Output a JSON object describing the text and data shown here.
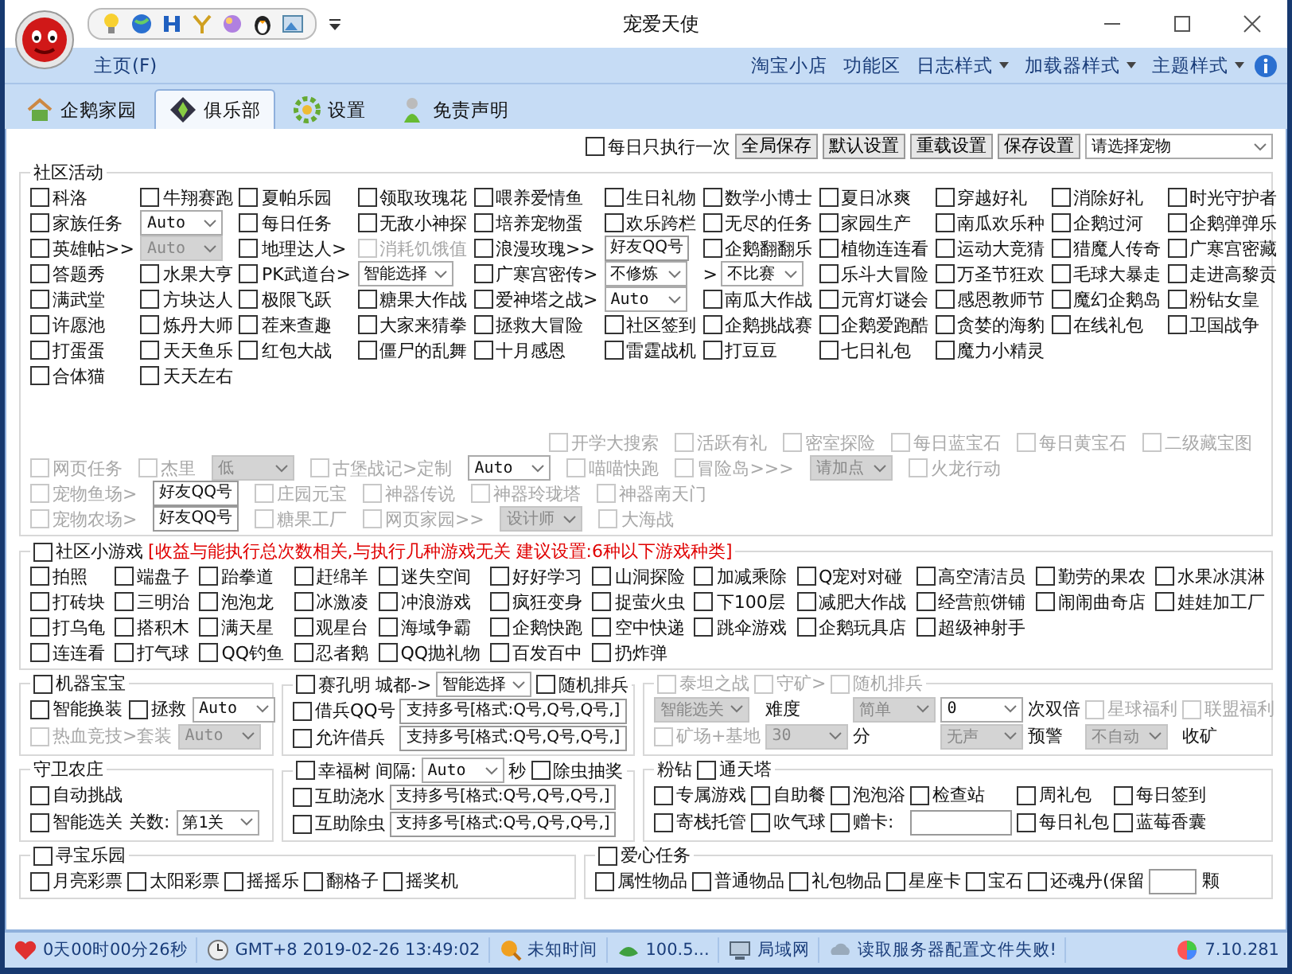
{
  "window": {
    "title": "宠爱天使"
  },
  "menu": {
    "home": "主页(F)",
    "items": [
      {
        "label": "淘宝小店",
        "has_dropdown": false
      },
      {
        "label": "功能区",
        "has_dropdown": false
      },
      {
        "label": "日志样式",
        "has_dropdown": true
      },
      {
        "label": "加载器样式",
        "has_dropdown": true
      },
      {
        "label": "主题样式",
        "has_dropdown": true
      }
    ]
  },
  "tabs": [
    {
      "label": "企鹅家园",
      "selected": false
    },
    {
      "label": "俱乐部",
      "selected": true
    },
    {
      "label": "设置",
      "selected": false
    },
    {
      "label": "免责声明",
      "selected": false
    }
  ],
  "toolbar": [
    {
      "kind": "check",
      "label": "每日只执行一次",
      "checked": false
    },
    {
      "kind": "button",
      "label": "全局保存"
    },
    {
      "kind": "button",
      "label": "默认设置"
    },
    {
      "kind": "button",
      "label": "重载设置"
    },
    {
      "kind": "button",
      "label": "保存设置"
    },
    {
      "kind": "select",
      "value": "请选择宠物"
    }
  ],
  "community": {
    "title": "社区活动",
    "rows": [
      [
        {
          "kind": "check",
          "label": "科洛",
          "checked": false
        },
        {
          "kind": "check",
          "label": "牛翔赛跑",
          "checked": false
        },
        {
          "kind": "check",
          "label": "夏帕乐园",
          "checked": false
        },
        {
          "kind": "check",
          "label": "领取玫瑰花",
          "checked": false
        },
        {
          "kind": "check",
          "label": "喂养爱情鱼",
          "checked": false
        },
        {
          "kind": "check",
          "label": "生日礼物",
          "checked": false
        },
        {
          "kind": "check",
          "label": "数学小博士",
          "checked": false
        },
        {
          "kind": "check",
          "label": "夏日冰爽",
          "checked": false
        },
        {
          "kind": "check",
          "label": "穿越好礼",
          "checked": false
        },
        {
          "kind": "check",
          "label": "消除好礼",
          "checked": false
        },
        {
          "kind": "check",
          "label": "时光守护者",
          "checked": false
        }
      ],
      [
        {
          "kind": "check",
          "label": "家族任务",
          "checked": false
        },
        {
          "kind": "select",
          "value": "Auto"
        },
        {
          "kind": "check",
          "label": "每日任务",
          "checked": false
        },
        {
          "kind": "check",
          "label": "无敌小神探",
          "checked": false
        },
        {
          "kind": "check",
          "label": "培养宠物蛋",
          "checked": false
        },
        {
          "kind": "check",
          "label": "欢乐跨栏",
          "checked": false
        },
        {
          "kind": "check",
          "label": "无尽的任务",
          "checked": false
        },
        {
          "kind": "check",
          "label": "家园生产",
          "checked": false
        },
        {
          "kind": "check",
          "label": "南瓜欢乐种",
          "checked": false
        },
        {
          "kind": "check",
          "label": "企鹅过河",
          "checked": false
        },
        {
          "kind": "check",
          "label": "企鹅弹弹乐",
          "checked": false
        }
      ],
      [
        {
          "kind": "check",
          "label": "英雄帖>>",
          "checked": false,
          "disabled": false
        },
        {
          "kind": "select",
          "value": "Auto",
          "disabled": true
        },
        {
          "kind": "check",
          "label": "地理达人>",
          "checked": false,
          "disabled": false
        },
        {
          "kind": "check",
          "label": "消耗饥饿值",
          "checked": false,
          "disabled": true
        },
        {
          "kind": "check",
          "label": "浪漫玫瑰>>",
          "checked": false,
          "disabled": false
        },
        {
          "kind": "input",
          "value": "好友QQ号",
          "disabled": false
        },
        {
          "kind": "check",
          "label": "企鹅翻翻乐",
          "checked": false,
          "disabled": false
        },
        {
          "kind": "check",
          "label": "植物连连看",
          "checked": false,
          "disabled": false
        },
        {
          "kind": "check",
          "label": "运动大竞猜",
          "checked": false,
          "disabled": false
        },
        {
          "kind": "check",
          "label": "猎魔人传奇",
          "checked": false,
          "disabled": false
        },
        {
          "kind": "check",
          "label": "广寒宫密藏",
          "checked": false,
          "disabled": false
        }
      ],
      [
        {
          "kind": "check",
          "label": "答题秀",
          "checked": false
        },
        {
          "kind": "check",
          "label": "水果大亨",
          "checked": false
        },
        {
          "kind": "check",
          "label": "PK武道台>",
          "checked": false
        },
        {
          "kind": "select",
          "value": "智能选择"
        },
        {
          "kind": "check",
          "label": "广寒宫密传>",
          "checked": false
        },
        {
          "kind": "select",
          "value": "不修炼"
        },
        {
          "kind": "select",
          "prefix": ">",
          "value": "不比赛"
        },
        {
          "kind": "check",
          "label": "乐斗大冒险",
          "checked": false
        },
        {
          "kind": "check",
          "label": "万圣节狂欢",
          "checked": false
        },
        {
          "kind": "check",
          "label": "毛球大暴走",
          "checked": false
        },
        {
          "kind": "check",
          "label": "走进高黎贡",
          "checked": false
        }
      ],
      [
        {
          "kind": "check",
          "label": "满武堂",
          "checked": false
        },
        {
          "kind": "check",
          "label": "方块达人",
          "checked": false
        },
        {
          "kind": "check",
          "label": "极限飞跃",
          "checked": false
        },
        {
          "kind": "check",
          "label": "糖果大作战",
          "checked": false
        },
        {
          "kind": "check",
          "label": "爱神塔之战>",
          "checked": false
        },
        {
          "kind": "select",
          "value": "Auto"
        },
        {
          "kind": "check",
          "label": "南瓜大作战",
          "checked": false
        },
        {
          "kind": "check",
          "label": "元宵灯谜会",
          "checked": false
        },
        {
          "kind": "check",
          "label": "感恩教师节",
          "checked": false
        },
        {
          "kind": "check",
          "label": "魔幻企鹅岛",
          "checked": false
        },
        {
          "kind": "check",
          "label": "粉钻女皇",
          "checked": false
        }
      ],
      [
        {
          "kind": "check",
          "label": "许愿池",
          "checked": false
        },
        {
          "kind": "check",
          "label": "炼丹大师",
          "checked": false
        },
        {
          "kind": "check",
          "label": "茬来查趣",
          "checked": false
        },
        {
          "kind": "check",
          "label": "大家来猜拳",
          "checked": false
        },
        {
          "kind": "check",
          "label": "拯救大冒险",
          "checked": false
        },
        {
          "kind": "check",
          "label": "社区签到",
          "checked": false
        },
        {
          "kind": "check",
          "label": "企鹅挑战赛",
          "checked": false
        },
        {
          "kind": "check",
          "label": "企鹅爱跑酷",
          "checked": false
        },
        {
          "kind": "check",
          "label": "贪婪的海豹",
          "checked": false
        },
        {
          "kind": "check",
          "label": "在线礼包",
          "checked": false
        },
        {
          "kind": "check",
          "label": "卫国战争",
          "checked": false
        }
      ],
      [
        {
          "kind": "check",
          "label": "打蛋蛋",
          "checked": false
        },
        {
          "kind": "check",
          "label": "天天鱼乐",
          "checked": false
        },
        {
          "kind": "check",
          "label": "红包大战",
          "checked": false
        },
        {
          "kind": "check",
          "label": "僵尸的乱舞",
          "checked": false
        },
        {
          "kind": "check",
          "label": "十月感恩",
          "checked": false
        },
        {
          "kind": "check",
          "label": "雷霆战机",
          "checked": false
        },
        {
          "kind": "check",
          "label": "打豆豆",
          "checked": false
        },
        {
          "kind": "check",
          "label": "七日礼包",
          "checked": false
        },
        {
          "kind": "check",
          "label": "魔力小精灵",
          "checked": false
        }
      ],
      [
        {
          "kind": "check",
          "label": "合体猫",
          "checked": false
        },
        {
          "kind": "check",
          "label": "天天左右",
          "checked": false
        }
      ]
    ],
    "gray_rows": [
      [
        {
          "kind": "check",
          "label": "开学大搜索",
          "checked": false,
          "disabled": true
        },
        {
          "kind": "check",
          "label": "活跃有礼",
          "checked": false,
          "disabled": true
        },
        {
          "kind": "check",
          "label": "密室探险",
          "checked": false,
          "disabled": true
        },
        {
          "kind": "check",
          "label": "每日蓝宝石",
          "checked": false,
          "disabled": true
        },
        {
          "kind": "check",
          "label": "每日黄宝石",
          "checked": false,
          "disabled": true
        },
        {
          "kind": "check",
          "label": "二级藏宝图",
          "checked": false,
          "disabled": true
        }
      ],
      [
        {
          "kind": "check",
          "label": "网页任务",
          "checked": false,
          "disabled": true
        },
        {
          "kind": "check",
          "label": "杰里",
          "checked": false,
          "disabled": true
        },
        {
          "kind": "select",
          "value": "低",
          "disabled": true
        },
        {
          "kind": "check",
          "label": "古堡战记>定制",
          "checked": false,
          "disabled": true
        },
        {
          "kind": "select",
          "value": "Auto",
          "disabled": false
        },
        {
          "kind": "check",
          "label": "喵喵快跑",
          "checked": false,
          "disabled": true
        },
        {
          "kind": "check",
          "label": "冒险岛>>>",
          "checked": false,
          "disabled": true
        },
        {
          "kind": "select",
          "value": "请加点",
          "disabled": true
        },
        {
          "kind": "check",
          "label": "火龙行动",
          "checked": false,
          "disabled": true
        }
      ],
      [
        {
          "kind": "check",
          "label": "宠物鱼场>",
          "checked": false,
          "disabled": true
        },
        {
          "kind": "input",
          "value": "好友QQ号",
          "disabled": false
        },
        {
          "kind": "check",
          "label": "庄园元宝",
          "checked": false,
          "disabled": true
        },
        {
          "kind": "check",
          "label": "神器传说",
          "checked": false,
          "disabled": true
        },
        {
          "kind": "check",
          "label": "神器玲珑塔",
          "checked": false,
          "disabled": true
        },
        {
          "kind": "check",
          "label": "神器南天门",
          "checked": false,
          "disabled": true
        }
      ],
      [
        {
          "kind": "check",
          "label": "宠物农场>",
          "checked": false,
          "disabled": true
        },
        {
          "kind": "input",
          "value": "好友QQ号",
          "disabled": false
        },
        {
          "kind": "check",
          "label": "糖果工厂",
          "checked": false,
          "disabled": true
        },
        {
          "kind": "check",
          "label": "网页家园>>",
          "checked": false,
          "disabled": true
        },
        {
          "kind": "select",
          "value": "设计师",
          "disabled": true
        },
        {
          "kind": "check",
          "label": "大海战",
          "checked": false,
          "disabled": true
        }
      ]
    ]
  },
  "mini_games": {
    "header": {
      "kind": "check",
      "label": "社区小游戏",
      "checked": false
    },
    "note": "[收益与能执行总次数相关,与执行几种游戏无关 建议设置:6种以下游戏种类]",
    "rows": [
      [
        {
          "kind": "check",
          "label": "拍照",
          "checked": false
        },
        {
          "kind": "check",
          "label": "端盘子",
          "checked": false
        },
        {
          "kind": "check",
          "label": "跆拳道",
          "checked": false
        },
        {
          "kind": "check",
          "label": "赶绵羊",
          "checked": false
        },
        {
          "kind": "check",
          "label": "迷失空间",
          "checked": false
        },
        {
          "kind": "check",
          "label": "好好学习",
          "checked": false
        },
        {
          "kind": "check",
          "label": "山洞探险",
          "checked": false
        },
        {
          "kind": "check",
          "label": "加减乘除",
          "checked": false
        },
        {
          "kind": "check",
          "label": "Q宠对对碰",
          "checked": false
        },
        {
          "kind": "check",
          "label": "高空清洁员",
          "checked": false
        },
        {
          "kind": "check",
          "label": "勤劳的果农",
          "checked": false
        },
        {
          "kind": "check",
          "label": "水果冰淇淋",
          "checked": false
        }
      ],
      [
        {
          "kind": "check",
          "label": "打砖块",
          "checked": false
        },
        {
          "kind": "check",
          "label": "三明治",
          "checked": false
        },
        {
          "kind": "check",
          "label": "泡泡龙",
          "checked": false
        },
        {
          "kind": "check",
          "label": "冰激凌",
          "checked": false
        },
        {
          "kind": "check",
          "label": "冲浪游戏",
          "checked": false
        },
        {
          "kind": "check",
          "label": "疯狂变身",
          "checked": false
        },
        {
          "kind": "check",
          "label": "捉萤火虫",
          "checked": false
        },
        {
          "kind": "check",
          "label": "下100层",
          "checked": false
        },
        {
          "kind": "check",
          "label": "减肥大作战",
          "checked": false
        },
        {
          "kind": "check",
          "label": "经营煎饼铺",
          "checked": false
        },
        {
          "kind": "check",
          "label": "闹闹曲奇店",
          "checked": false
        },
        {
          "kind": "check",
          "label": "娃娃加工厂",
          "checked": false
        }
      ],
      [
        {
          "kind": "check",
          "label": "打乌龟",
          "checked": false
        },
        {
          "kind": "check",
          "label": "搭积木",
          "checked": false
        },
        {
          "kind": "check",
          "label": "满天星",
          "checked": false
        },
        {
          "kind": "check",
          "label": "观星台",
          "checked": false
        },
        {
          "kind": "check",
          "label": "海域争霸",
          "checked": false
        },
        {
          "kind": "check",
          "label": "企鹅快跑",
          "checked": false
        },
        {
          "kind": "check",
          "label": "空中快递",
          "checked": false
        },
        {
          "kind": "check",
          "label": "跳伞游戏",
          "checked": false
        },
        {
          "kind": "check",
          "label": "企鹅玩具店",
          "checked": false
        },
        {
          "kind": "check",
          "label": "超级神射手",
          "checked": false
        }
      ],
      [
        {
          "kind": "check",
          "label": "连连看",
          "checked": false
        },
        {
          "kind": "check",
          "label": "打气球",
          "checked": false
        },
        {
          "kind": "check",
          "label": "QQ钓鱼",
          "checked": false
        },
        {
          "kind": "check",
          "label": "忍者鹅",
          "checked": false
        },
        {
          "kind": "check",
          "label": "QQ抛礼物",
          "checked": false
        },
        {
          "kind": "check",
          "label": "百发百中",
          "checked": false
        },
        {
          "kind": "check",
          "label": "扔炸弹",
          "checked": false
        }
      ]
    ]
  },
  "panel_rows": [
    [
      {
        "legend": [
          {
            "kind": "check",
            "label": "机器宝宝",
            "checked": false
          }
        ],
        "rows": [
          [
            {
              "kind": "check",
              "label": "智能换装",
              "checked": false,
              "disabled": false
            },
            {
              "kind": "check",
              "label": "拯救",
              "checked": false,
              "disabled": false
            },
            {
              "kind": "select",
              "value": "Auto",
              "disabled": false
            }
          ],
          [
            {
              "kind": "check",
              "label": "热血竞技>套装",
              "checked": false,
              "disabled": true,
              "select": {
                "kind": "select",
                "value": "Auto",
                "disabled": true
              }
            }
          ]
        ]
      },
      {
        "legend": [
          {
            "kind": "check",
            "label": "赛孔明",
            "checked": false
          },
          {
            "kind": "text",
            "label": "城都->"
          },
          {
            "kind": "select",
            "value": "智能选择"
          },
          {
            "kind": "check",
            "label": "随机排兵",
            "checked": false
          }
        ],
        "rows": [
          [
            {
              "kind": "check",
              "label": "借兵QQ号",
              "checked": false
            },
            {
              "kind": "input",
              "value": "支持多号[格式:Q号,Q号,Q号,]"
            }
          ],
          [
            {
              "kind": "check",
              "label": "允许借兵",
              "checked": false
            },
            {
              "kind": "input",
              "value": "支持多号[格式:Q号,Q号,Q号,]"
            }
          ]
        ]
      },
      {
        "legend": [
          {
            "kind": "check",
            "label": "泰坦之战",
            "checked": false,
            "disabled": true
          },
          {
            "kind": "check",
            "label": "守矿>",
            "checked": false,
            "disabled": true
          },
          {
            "kind": "check",
            "label": "随机排兵",
            "checked": false,
            "disabled": true
          }
        ],
        "rows": [
          [
            {
              "kind": "select",
              "value": "智能选关",
              "disabled": true
            },
            {
              "kind": "text",
              "label": "难度",
              "disabled": false
            },
            {
              "kind": "select",
              "value": "简单",
              "disabled": true
            },
            {
              "kind": "select",
              "value": "0",
              "disabled": false
            },
            {
              "kind": "text",
              "label": "次双倍",
              "disabled": false
            },
            {
              "kind": "check",
              "label": "星球福利",
              "checked": false,
              "disabled": true
            },
            {
              "kind": "check",
              "label": "联盟福利",
              "checked": false,
              "disabled": true
            }
          ],
          [
            {
              "kind": "check",
              "label": "矿场+基地",
              "checked": false,
              "disabled": true
            },
            {
              "kind": "select",
              "value": "30",
              "disabled": true
            },
            {
              "kind": "text",
              "label": "分",
              "disabled": false
            },
            {
              "kind": "select",
              "value": "无声",
              "disabled": true
            },
            {
              "kind": "text",
              "label": "预警",
              "disabled": false
            },
            {
              "kind": "select",
              "value": "不自动",
              "disabled": true
            },
            {
              "kind": "text",
              "label": "收矿",
              "disabled": false
            }
          ]
        ]
      }
    ],
    [
      {
        "legend": [
          {
            "kind": "text",
            "label": "守卫农庄"
          }
        ],
        "rows": [
          [
            {
              "kind": "check",
              "label": "自动挑战",
              "checked": false
            }
          ],
          [
            {
              "kind": "check",
              "label": "智能选关",
              "checked": false
            },
            {
              "kind": "text",
              "label": "关数:"
            },
            {
              "kind": "select",
              "value": "第1关"
            }
          ]
        ]
      },
      {
        "legend": [
          {
            "kind": "check",
            "label": "幸福树",
            "checked": false
          },
          {
            "kind": "text",
            "label": "间隔:"
          },
          {
            "kind": "select",
            "value": "Auto"
          },
          {
            "kind": "text",
            "label": "秒"
          },
          {
            "kind": "check",
            "label": "除虫抽奖",
            "checked": false
          }
        ],
        "rows": [
          [
            {
              "kind": "check",
              "label": "互助浇水",
              "checked": false
            },
            {
              "kind": "input",
              "value": "支持多号[格式:Q号,Q号,Q号,]"
            }
          ],
          [
            {
              "kind": "check",
              "label": "互助除虫",
              "checked": false
            },
            {
              "kind": "input",
              "value": "支持多号[格式:Q号,Q号,Q号,]"
            }
          ]
        ]
      },
      {
        "legend": [
          {
            "kind": "text",
            "label": "粉钻"
          },
          {
            "kind": "check",
            "label": "通天塔",
            "checked": false
          }
        ],
        "rows": [
          [
            {
              "kind": "check",
              "label": "专属游戏",
              "checked": false
            },
            {
              "kind": "check",
              "label": "自助餐",
              "checked": false
            },
            {
              "kind": "check",
              "label": "泡泡浴",
              "checked": false
            },
            {
              "kind": "check",
              "label": "检查站",
              "checked": false
            },
            {
              "kind": "check",
              "label": "周礼包",
              "checked": false
            },
            {
              "kind": "check",
              "label": "每日签到",
              "checked": false
            }
          ],
          [
            {
              "kind": "check",
              "label": "寄栈托管",
              "checked": false
            },
            {
              "kind": "check",
              "label": "吹气球",
              "checked": false
            },
            {
              "kind": "check",
              "label": "赠卡:",
              "checked": false
            },
            {
              "kind": "input"
            },
            {
              "kind": "check",
              "label": "每日礼包",
              "checked": false
            },
            {
              "kind": "check",
              "label": "蓝莓香囊",
              "checked": false
            }
          ]
        ]
      }
    ],
    [
      {
        "legend": [
          {
            "kind": "check",
            "label": "寻宝乐园",
            "checked": false
          }
        ],
        "rows": [
          [
            {
              "kind": "check",
              "label": "月亮彩票",
              "checked": false
            },
            {
              "kind": "check",
              "label": "太阳彩票",
              "checked": false
            },
            {
              "kind": "check",
              "label": "摇摇乐",
              "checked": false
            },
            {
              "kind": "check",
              "label": "翻格子",
              "checked": false
            },
            {
              "kind": "check",
              "label": "摇奖机",
              "checked": false
            }
          ]
        ]
      },
      {
        "legend": [
          {
            "kind": "check",
            "label": "爱心任务",
            "checked": false
          }
        ],
        "rows": [
          [
            {
              "kind": "check",
              "label": "属性物品",
              "checked": false
            },
            {
              "kind": "check",
              "label": "普通物品",
              "checked": false
            },
            {
              "kind": "check",
              "label": "礼包物品",
              "checked": false
            },
            {
              "kind": "check",
              "label": "星座卡",
              "checked": false
            },
            {
              "kind": "check",
              "label": "宝石",
              "checked": false
            },
            {
              "kind": "check",
              "label": "还魂丹(保留",
              "checked": false
            },
            {
              "kind": "input"
            },
            {
              "kind": "text",
              "label": "颗"
            }
          ]
        ]
      }
    ]
  ],
  "status_bar": [
    {
      "text": "0天00时00分26秒"
    },
    {
      "text": "GMT+8 2019-02-26 13:49:02"
    },
    {
      "text": "未知时间"
    },
    {
      "text": "100.5..."
    },
    {
      "text": "局域网"
    },
    {
      "text": "读取服务器配置文件失败!"
    },
    {
      "text": "7.10.281"
    }
  ]
}
